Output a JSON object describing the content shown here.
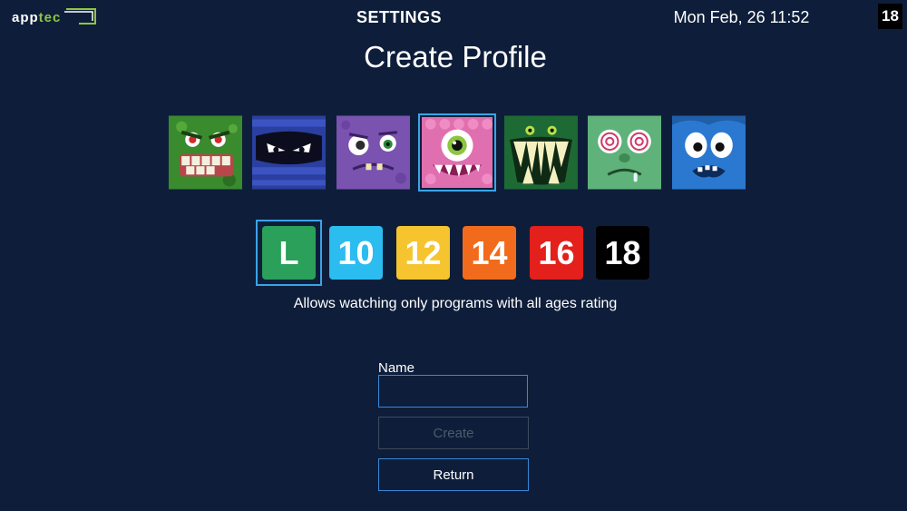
{
  "header": {
    "logo": {
      "text_main": "app",
      "text_accent": "tec"
    },
    "title": "SETTINGS",
    "datetime": "Mon Feb, 26 11:52",
    "age_badge": "18"
  },
  "page": {
    "title": "Create Profile",
    "avatars": [
      {
        "icon": "green-monster-avatar-icon",
        "color": "#3a8a2e"
      },
      {
        "icon": "blue-ninja-avatar-icon",
        "color": "#2a3fa0"
      },
      {
        "icon": "purple-monster-avatar-icon",
        "color": "#7a52b0"
      },
      {
        "icon": "pink-cyclops-avatar-icon",
        "color": "#e06fb0",
        "selected": true
      },
      {
        "icon": "green-fang-monster-avatar-icon",
        "color": "#1e6a34"
      },
      {
        "icon": "green-hypno-monster-avatar-icon",
        "color": "#5fb27a"
      },
      {
        "icon": "blue-scared-monster-avatar-icon",
        "color": "#2b78d0"
      }
    ],
    "ratings": [
      {
        "label": "L",
        "color": "#2aa05a",
        "selected": true
      },
      {
        "label": "10",
        "color": "#2bbcf0"
      },
      {
        "label": "12",
        "color": "#f6c42e"
      },
      {
        "label": "14",
        "color": "#f26b1d"
      },
      {
        "label": "16",
        "color": "#e3201b"
      },
      {
        "label": "18",
        "color": "#000000"
      }
    ],
    "description": "Allows watching only programs with all ages rating",
    "name_label": "Name",
    "name_value": "",
    "create_label": "Create",
    "return_label": "Return"
  },
  "colors": {
    "background": "#0e1e3a",
    "focus_border": "#3aa3e8",
    "logo_accent": "#8cc63f"
  }
}
